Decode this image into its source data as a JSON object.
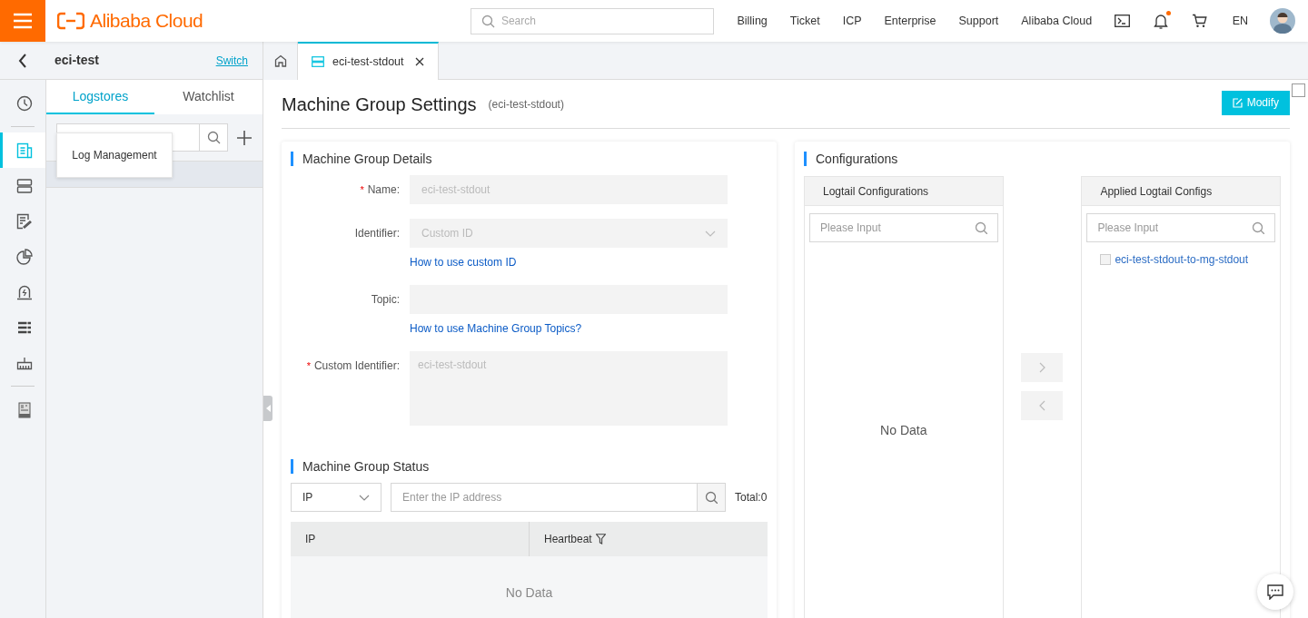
{
  "header": {
    "brand": "Alibaba Cloud",
    "search": {
      "placeholder": "Search"
    },
    "nav": [
      "Billing",
      "Ticket",
      "ICP",
      "Enterprise",
      "Support",
      "Alibaba Cloud"
    ],
    "notification_dot": true,
    "language": "EN"
  },
  "project": {
    "name": "eci-test",
    "switch": "Switch"
  },
  "tabs": [
    {
      "kind": "home",
      "selected": false
    },
    {
      "kind": "page",
      "label": "eci-test-stdout",
      "selected": true
    }
  ],
  "rail": [
    {
      "selected": false
    },
    {
      "selected": true
    },
    {
      "selected": false
    },
    {
      "selected": false
    },
    {
      "selected": false
    },
    {
      "selected": false
    },
    {
      "selected": false
    },
    {
      "selected": false
    },
    {
      "selected": false
    }
  ],
  "corner_checkbox": {
    "checked": false
  },
  "tooltip": "Log Management",
  "side_tabs": [
    {
      "label": "Logstores",
      "selected": true
    },
    {
      "label": "Watchlist",
      "selected": false
    }
  ],
  "tree": [
    {
      "selected": true
    }
  ],
  "page": {
    "title": "Machine Group Settings",
    "subtitle": "(eci-test-stdout)",
    "modify": "Modify"
  },
  "details": {
    "title": "Machine Group Details",
    "fields": [
      {
        "kind": "input",
        "label": "Name:",
        "required_mark": "*",
        "value": "eci-test-stdout"
      },
      {
        "kind": "select",
        "label": "Identifier:",
        "value": "Custom ID",
        "link": "How to use custom ID"
      },
      {
        "kind": "input",
        "label": "Topic:",
        "link": "How to use Machine Group Topics?"
      },
      {
        "kind": "textarea",
        "label": "Custom Identifier:",
        "required_mark": "*",
        "value": "eci-test-stdout"
      }
    ]
  },
  "status": {
    "title": "Machine Group Status",
    "filter": "IP",
    "search": {
      "placeholder": "Enter the IP address"
    },
    "total": "Total:0",
    "columns": [
      "IP",
      "Heartbeat"
    ],
    "empty": "No Data"
  },
  "configurations": {
    "title": "Configurations",
    "available": {
      "title": "Logtail Configurations",
      "placeholder": "Please Input",
      "empty": "No Data"
    },
    "applied": {
      "title": "Applied Logtail Configs",
      "placeholder": "Please Input",
      "items": [
        {
          "label": "eci-test-stdout-to-mg-stdout",
          "checked": false
        }
      ]
    }
  }
}
